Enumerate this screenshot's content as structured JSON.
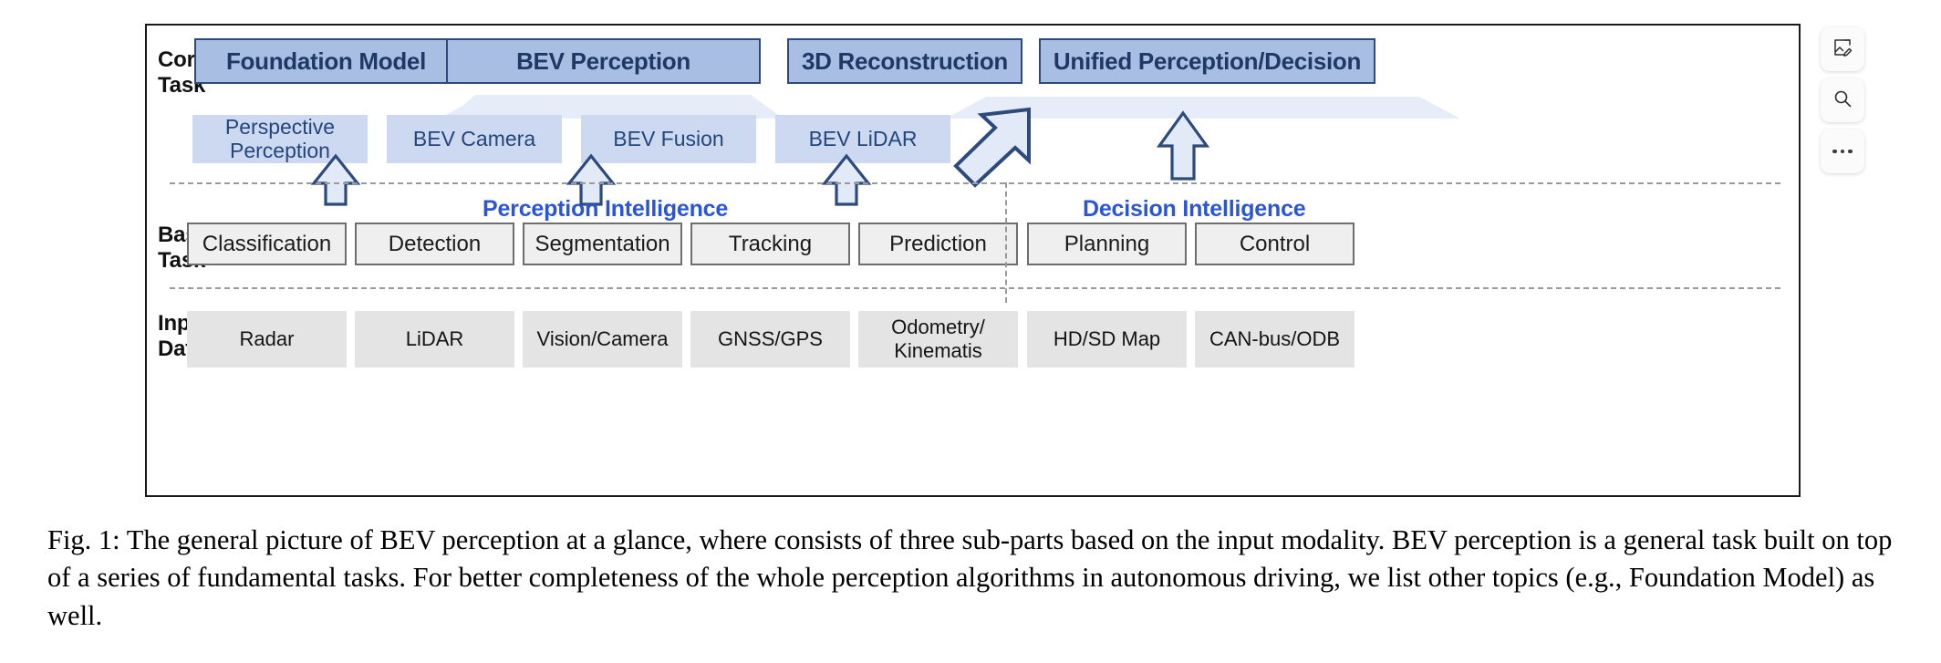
{
  "figure": {
    "row_labels": {
      "core": "Core\nTask",
      "basic": "Basic\nTask",
      "input": "Input\nData"
    },
    "core_tasks": [
      {
        "label": "Foundation Model"
      },
      {
        "label": "BEV Perception"
      },
      {
        "label": "3D Reconstruction"
      },
      {
        "label": "Unified Perception/Decision"
      }
    ],
    "sub_tasks": [
      {
        "label": "Perspective\nPerception"
      },
      {
        "label": "BEV Camera"
      },
      {
        "label": "BEV Fusion"
      },
      {
        "label": "BEV LiDAR"
      }
    ],
    "intelligence": {
      "perception": "Perception Intelligence",
      "decision": "Decision Intelligence"
    },
    "basic_tasks": [
      {
        "label": "Classification"
      },
      {
        "label": "Detection"
      },
      {
        "label": "Segmentation"
      },
      {
        "label": "Tracking"
      },
      {
        "label": "Prediction"
      },
      {
        "label": "Planning"
      },
      {
        "label": "Control"
      }
    ],
    "input_data": [
      {
        "label": "Radar"
      },
      {
        "label": "LiDAR"
      },
      {
        "label": "Vision/Camera"
      },
      {
        "label": "GNSS/GPS"
      },
      {
        "label": "Odometry/\nKinematis"
      },
      {
        "label": "HD/SD Map"
      },
      {
        "label": "CAN-bus/ODB"
      }
    ],
    "colors": {
      "core_box_fill": "#a8bfe3",
      "core_box_border": "#2c4a7c",
      "core_box_text": "#1f3864",
      "sub_box_fill": "#ccd9f0",
      "sub_box_text": "#24467d",
      "basic_box_fill": "#efefef",
      "basic_box_border": "#6e6e6e",
      "input_box_fill": "#e4e4e4",
      "intel_text": "#2a55d4",
      "arrow_fill": "#e2eaf8",
      "arrow_stroke": "#2c4a7c",
      "funnel_fill": "#e6edf9",
      "dash_line": "#9a9a9a",
      "frame_border": "#1a1a1a"
    }
  },
  "caption": {
    "text": "Fig. 1: The general picture of BEV perception at a glance, where consists of three sub-parts based on the input modality. BEV perception is a general task built on top of a series of fundamental tasks. For better completeness of the whole perception algorithms in autonomous driving, we list other topics (e.g., Foundation Model) as well."
  },
  "toolbar": {
    "buttons": [
      {
        "name": "image-edit-icon",
        "tooltip": "Edit image"
      },
      {
        "name": "search-icon",
        "tooltip": "Search"
      },
      {
        "name": "more-options-icon",
        "tooltip": "More"
      }
    ]
  }
}
